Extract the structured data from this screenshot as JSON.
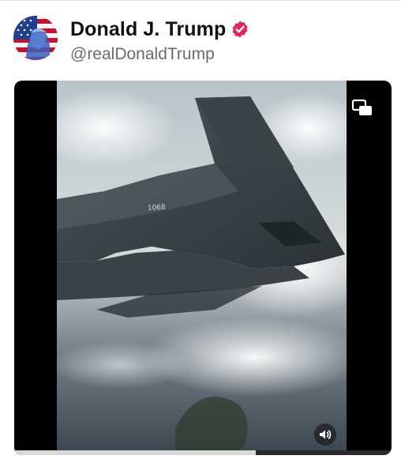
{
  "post": {
    "author": {
      "display_name": "Donald J. Trump",
      "handle": "@realDonaldTrump",
      "verified": true,
      "verified_color": "#e0245e"
    }
  },
  "media": {
    "type": "video",
    "progress": 0.64,
    "icons": {
      "pip": "picture-in-picture-icon",
      "volume": "speaker-icon"
    }
  }
}
